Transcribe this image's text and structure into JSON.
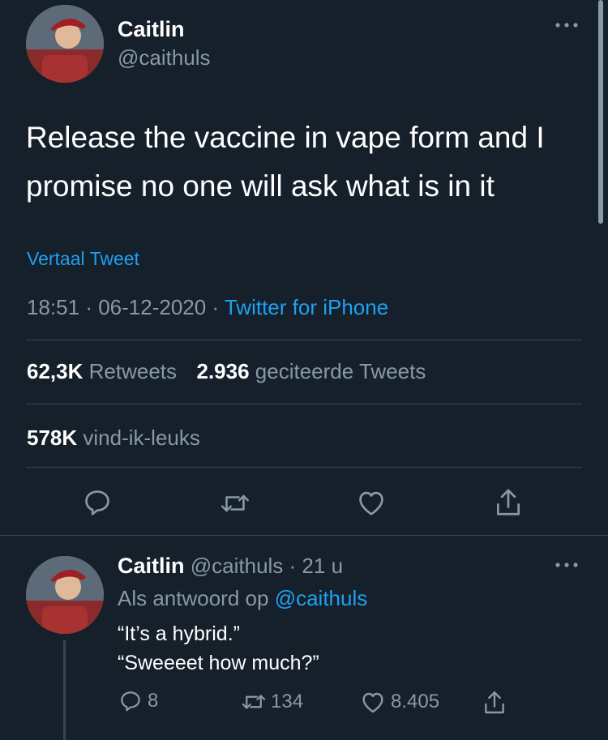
{
  "tweet": {
    "author_name": "Caitlin",
    "author_handle": "@caithuls",
    "more_icon": "more-dots-icon",
    "text_line1": "Release the vaccine in vape form and I",
    "text_line2": "promise no one will ask what is in it",
    "translate_label": "Vertaal Tweet",
    "time": "18:51",
    "date": "06-12-2020",
    "source": "Twitter for iPhone",
    "retweets_count": "62,3K",
    "retweets_label": "Retweets",
    "quotes_count": "2.936",
    "quotes_label": "geciteerde Tweets",
    "likes_count": "578K",
    "likes_label": "vind-ik-leuks",
    "actions": [
      "reply-icon",
      "retweet-icon",
      "like-icon",
      "share-icon"
    ]
  },
  "reply": {
    "author_name": "Caitlin",
    "author_handle": "@caithuls",
    "time_ago": "21 u",
    "replying_prefix": "Als antwoord op",
    "replying_to": "@caithuls",
    "text_line1": "“It’s a hybrid.”",
    "text_line2": "“Sweeeet how much?”",
    "reply_count": "8",
    "retweet_count": "134",
    "like_count": "8.405"
  },
  "colors": {
    "background": "#15202b",
    "accent": "#1da1f2",
    "secondary_text": "#8899a6",
    "divider": "#38444d"
  }
}
